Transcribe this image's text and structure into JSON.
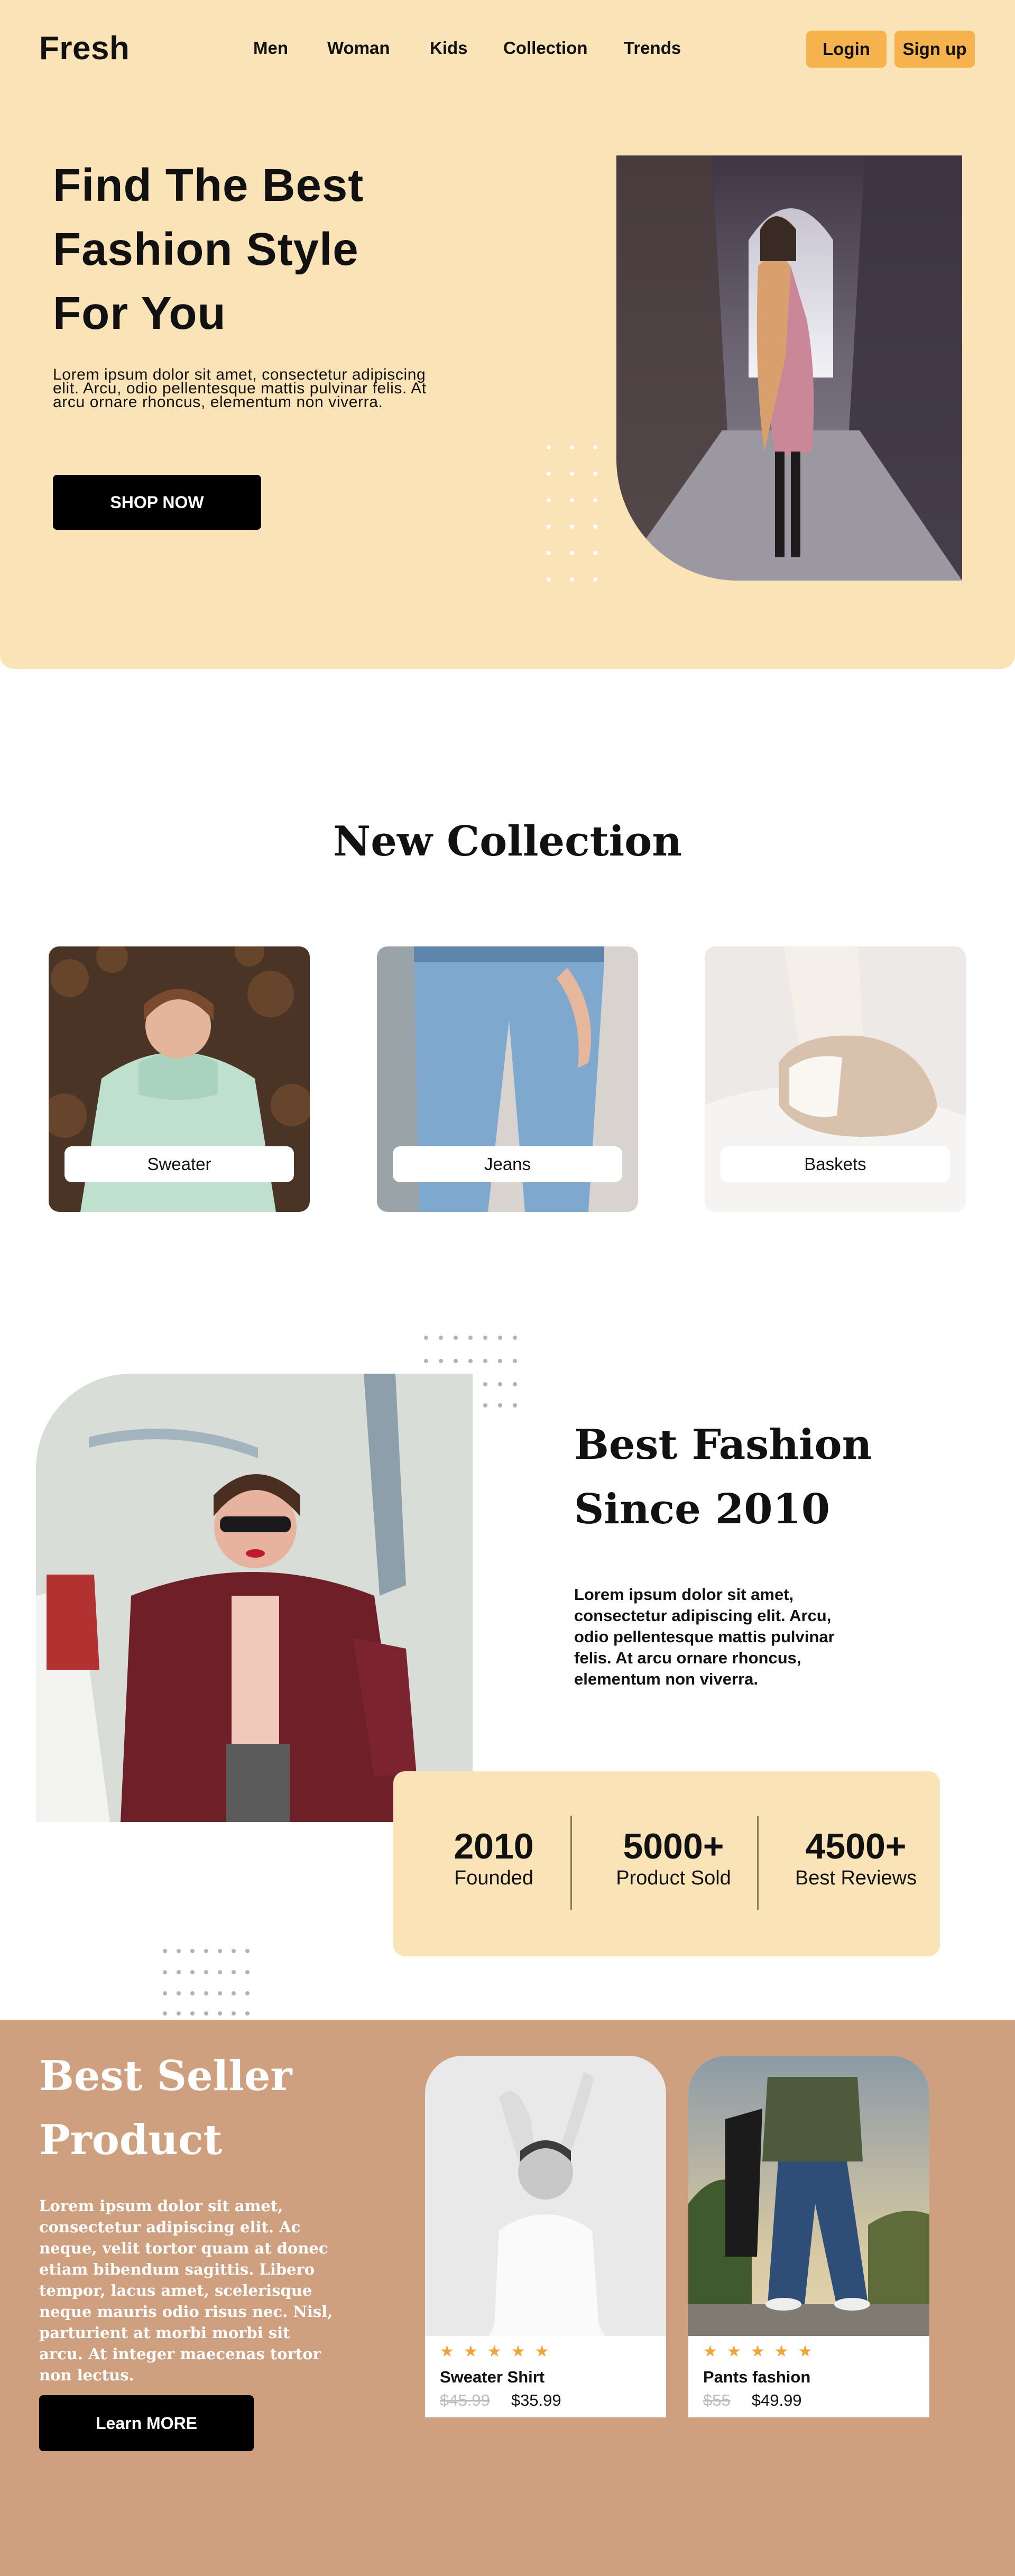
{
  "header": {
    "logo": "Fresh",
    "nav": [
      "Men",
      "Woman",
      "Kids",
      "Collection",
      "Trends"
    ],
    "login": "Login",
    "signup": "Sign up"
  },
  "hero": {
    "title_lines": [
      "Find The Best",
      "Fashion Style",
      "For You"
    ],
    "text": "Lorem ipsum dolor sit amet, consectetur adipiscing elit. Arcu, odio pellentesque mattis pulvinar felis. At arcu ornare rhoncus, elementum non viverra.",
    "cta": "SHOP NOW"
  },
  "new_collection": {
    "title": "New Collection",
    "cards": [
      {
        "label": "Sweater"
      },
      {
        "label": "Jeans"
      },
      {
        "label": "Baskets"
      }
    ]
  },
  "best_fashion": {
    "title_lines": [
      "Best Fashion",
      "Since 2010"
    ],
    "text": "Lorem ipsum dolor sit amet, consectetur adipiscing elit. Arcu, odio pellentesque mattis pulvinar felis. At arcu ornare rhoncus, elementum non viverra.",
    "stats": [
      {
        "value": "2010",
        "label": "Founded"
      },
      {
        "value": "5000+",
        "label": "Product Sold"
      },
      {
        "value": "4500+",
        "label": "Best Reviews"
      }
    ]
  },
  "best_seller": {
    "title_lines": [
      "Best Seller",
      "Product"
    ],
    "text": "Lorem ipsum dolor sit amet, consectetur adipiscing elit. Ac neque, velit tortor quam at donec etiam bibendum sagittis. Libero tempor, lacus amet, scelerisque neque mauris odio risus nec. Nisl, parturient at morbi morbi sit arcu. At integer maecenas tortor non lectus.",
    "cta": "Learn MORE",
    "products": [
      {
        "name": "Sweater Shirt",
        "old_price": "$45.99",
        "price": "$35.99",
        "rating": 5
      },
      {
        "name": "Pants fashion",
        "old_price": "$55",
        "price": "$49.99",
        "rating": 5
      }
    ]
  },
  "colors": {
    "cream": "#fae3b6",
    "accent": "#f5b24d",
    "tan": "#cfa080",
    "star": "#f2a33a"
  }
}
